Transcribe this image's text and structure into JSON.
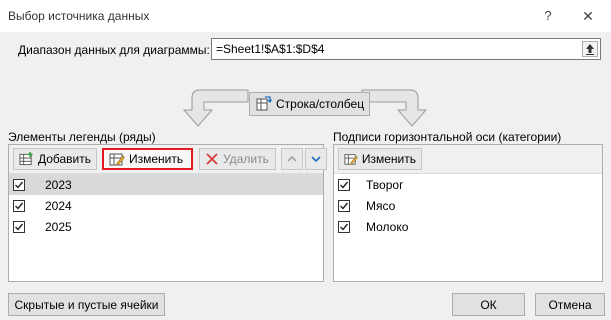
{
  "window": {
    "title": "Выбор источника данных",
    "help": "?",
    "close": "✕"
  },
  "range": {
    "label": "Диапазон данных для диаграммы:",
    "value": "=Sheet1!$A$1:$D$4"
  },
  "switch_label": "Строка/столбец",
  "legend": {
    "label": "Элементы легенды (ряды)",
    "add_label": "Добавить",
    "edit_label": "Изменить",
    "remove_label": "Удалить",
    "items": [
      {
        "label": "2023",
        "checked": true,
        "selected": true
      },
      {
        "label": "2024",
        "checked": true,
        "selected": false
      },
      {
        "label": "2025",
        "checked": true,
        "selected": false
      }
    ]
  },
  "axis": {
    "label": "Подписи горизонтальной оси (категории)",
    "edit_label": "Изменить",
    "items": [
      {
        "label": "Творог",
        "checked": true
      },
      {
        "label": "Мясо",
        "checked": true
      },
      {
        "label": "Молоко",
        "checked": true
      }
    ]
  },
  "buttons": {
    "hidden_cells": "Скрытые и пустые ячейки",
    "ok": "ОК",
    "cancel": "Отмена"
  },
  "colors": {
    "highlight": "#e51b24",
    "accent": "#1f6fc1"
  }
}
